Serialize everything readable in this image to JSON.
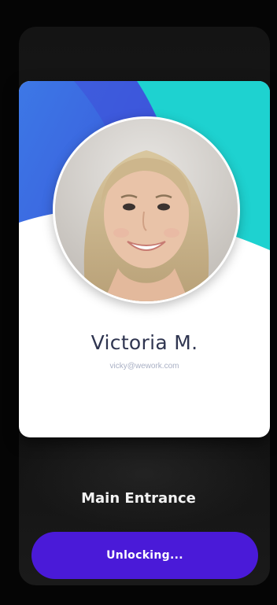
{
  "profile": {
    "name": "Victoria M.",
    "email": "vicky@wework.com"
  },
  "access": {
    "location": "Main Entrance",
    "button_label": "Unlocking..."
  },
  "colors": {
    "button": "#4a1ad8",
    "card_blue": "#3a66e0",
    "card_teal": "#1ed2d0",
    "name_text": "#2f3550"
  }
}
